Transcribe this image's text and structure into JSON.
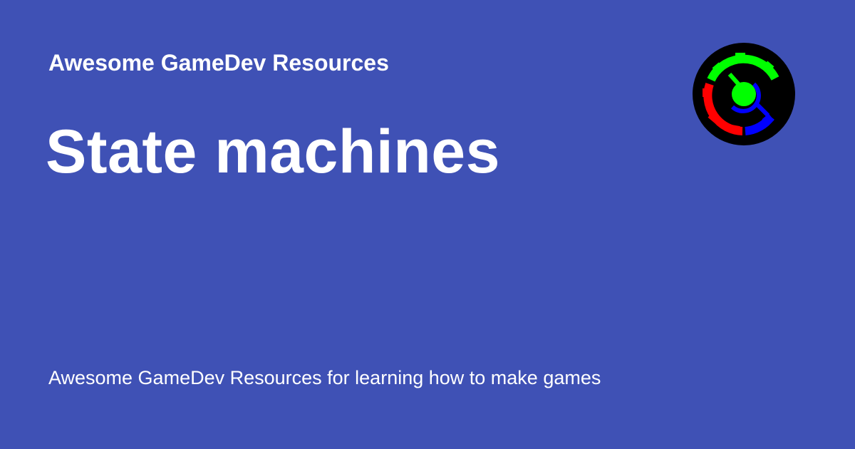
{
  "card": {
    "background_color": "#3F51B5",
    "text_color": "#FFFFFF",
    "site_title": "Awesome GameDev Resources",
    "page_title": "State machines",
    "description": "Awesome GameDev Resources for learning how to make games"
  },
  "logo": {
    "icon": "gamedev-gear-logo-icon",
    "colors": {
      "background": "#000000",
      "green": "#00FF00",
      "red": "#FF0000",
      "blue": "#0000FF"
    }
  }
}
